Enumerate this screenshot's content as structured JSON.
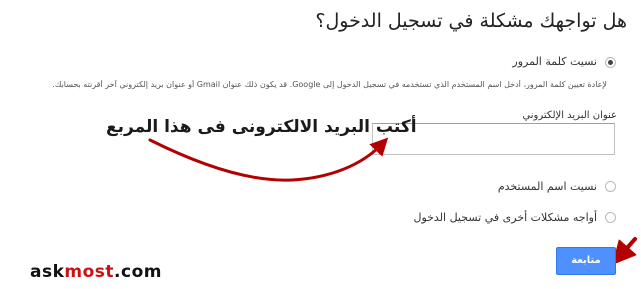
{
  "page": {
    "title": "هل تواجهك مشكلة في تسجيل الدخول؟"
  },
  "options": {
    "forgot_password": {
      "label": "نسيت كلمة المرور",
      "selected": true,
      "description": "لإعادة تعيين كلمة المرور، أدخل اسم المستخدم الذي تستخدمه في تسجيل الدخول إلى Google. قد يكون ذلك عنوان Gmail أو عنوان بريد إلكتروني آخر أقرنته بحسابك.",
      "email_field_label": "عنوان البريد الإلكتروني",
      "email_value": ""
    },
    "forgot_username": {
      "label": "نسيت اسم المستخدم",
      "selected": false
    },
    "other_problems": {
      "label": "أواجه مشكلات أخرى في تسجيل الدخول",
      "selected": false
    }
  },
  "actions": {
    "continue_label": "متابعة"
  },
  "annotation": {
    "text": "أكتب البريد الالكترونى فى هذا المربع",
    "arrow_color": "#b30000"
  },
  "watermark": {
    "part1": "ask",
    "part2": "most",
    "part3": ".com"
  },
  "colors": {
    "button": "#4d90fe",
    "button_border": "#3079ed"
  }
}
